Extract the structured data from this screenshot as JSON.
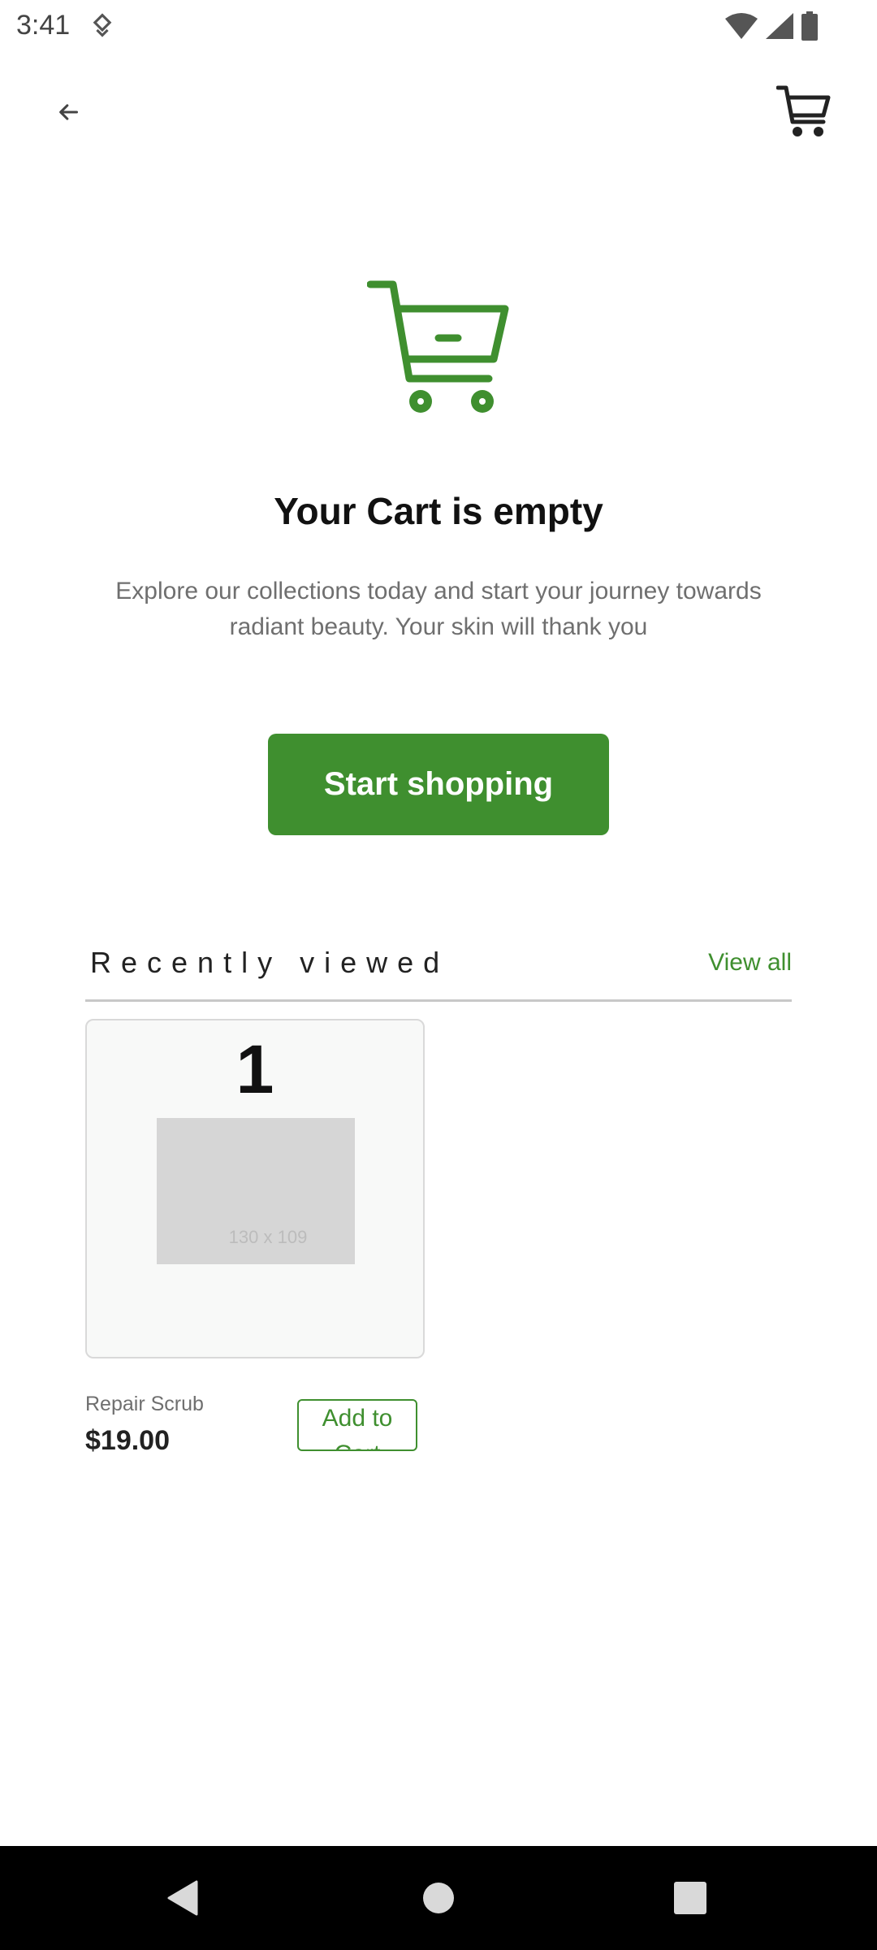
{
  "status_bar": {
    "time": "3:41",
    "icons": [
      "data-saver-icon",
      "wifi-icon",
      "signal-icon",
      "battery-icon"
    ]
  },
  "app_bar": {
    "back_icon": "arrow-back-icon",
    "cart_icon": "shopping-cart-icon"
  },
  "empty_state": {
    "icon": "empty-cart-icon",
    "title": "Your Cart is empty",
    "subtitle": "Explore our collections today and start your journey towards radiant beauty. Your skin will thank you",
    "button_label": "Start shopping"
  },
  "recently_viewed": {
    "title": "Recently viewed",
    "view_all_label": "View all",
    "items": [
      {
        "badge_number": "1",
        "image_placeholder_text": "130 x 109",
        "name": "Repair Scrub",
        "price": "$19.00",
        "add_button_label": "Add to Cart"
      }
    ]
  },
  "nav_bar": {
    "icons": [
      "back-triangle-icon",
      "home-circle-icon",
      "recents-square-icon"
    ]
  },
  "colors": {
    "accent": "#3f8f2f",
    "text_primary": "#111111",
    "text_secondary": "#6f6f6f",
    "nav_background": "#000000"
  }
}
